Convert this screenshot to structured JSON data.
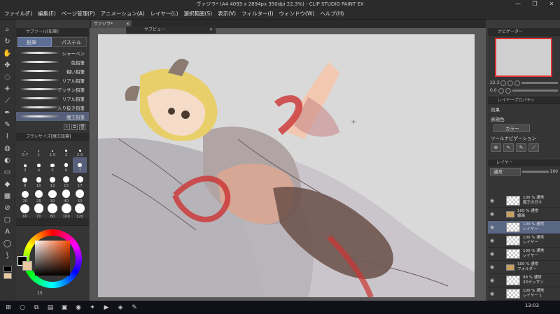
{
  "window": {
    "title": "ヴァジラ* (A4 4093 x 2894px 350dpi 22.3%) - CLIP STUDIO PAINT EX",
    "controls": [
      "—",
      "❐",
      "✕"
    ]
  },
  "menu": [
    "ファイル(F)",
    "編集(E)",
    "ページ管理(P)",
    "アニメーション(A)",
    "レイヤー(L)",
    "選択範囲(S)",
    "表示(V)",
    "フィルター(I)",
    "ウィンドウ(W)",
    "ヘルプ(H)"
  ],
  "tools": [
    "zoom-icon",
    "rotate-icon",
    "hand-icon",
    "move-icon",
    "lasso-icon",
    "auto-select-icon",
    "eyedropper-icon",
    "pen-icon",
    "pencil-icon",
    "brush-icon",
    "airbrush-icon",
    "blend-icon",
    "eraser-icon",
    "fill-icon",
    "gradient-icon",
    "figure-icon",
    "frame-icon",
    "text-icon",
    "balloon-icon",
    "line-correct-icon"
  ],
  "subtool": {
    "header": "サブツール[鉛筆]",
    "tabs": [
      "鉛筆",
      "パステル"
    ],
    "brushes": [
      "シャーペン",
      "色鉛筆",
      "粗い鉛筆",
      "リアル鉛筆",
      "デッサン鉛筆",
      "リアル鉛筆",
      "入り抜き鉛筆",
      "魔王鉛筆"
    ],
    "selected": "魔王鉛筆"
  },
  "brushsize": {
    "header": "ブラシサイズ[魔王鉛筆]",
    "sizes": [
      "0.7",
      "1",
      "1.5",
      "2",
      "2.5",
      "3",
      "4",
      "5",
      "6",
      "7",
      "8",
      "10",
      "12",
      "15",
      "17",
      "20",
      "25",
      "30",
      "40",
      "50",
      "60",
      "70",
      "80",
      "100",
      "120"
    ],
    "selected": "7"
  },
  "colorpanel": {
    "bottom_value": "15",
    "foreground": "#000000",
    "background": "#e8c9a0",
    "hue": "#ff4a00"
  },
  "document_tab": {
    "label": "ヴァジラ*",
    "close": "✕"
  },
  "subview": {
    "label": "サブビュー",
    "close": "✕"
  },
  "navigator": {
    "header": "ナビゲーター",
    "zoom": "22.3",
    "rotate": "0.0"
  },
  "layerprop": {
    "header": "レイヤープロパティ",
    "effect": "効果",
    "display_color": "表現色",
    "color_value": "カラー",
    "ruler_nav": "ツールナビゲーション"
  },
  "layers": {
    "header": "レイヤー",
    "blend": "通常",
    "opacity": "100",
    "rows": [
      {
        "line1": "100 % 通常",
        "line2": "魔王の日々"
      },
      {
        "line1": "100 % 通常",
        "line2": "線画"
      },
      {
        "line1": "100 % 通常",
        "line2": "レイヤー"
      },
      {
        "line1": "100 % 通常",
        "line2": "レイヤー"
      },
      {
        "line1": "100 % 通常",
        "line2": "レイヤー"
      },
      {
        "line1": "100 % 通常",
        "line2": "フォルダー"
      },
      {
        "line1": "98 % 通常",
        "line2": "3Dデッサン"
      },
      {
        "line1": "100 % 通常",
        "line2": "レイヤー 1"
      }
    ]
  },
  "taskbar": {
    "time": "13:03",
    "apps": [
      "windows-icon",
      "search-icon",
      "task-view-icon",
      "explorer-icon",
      "store-icon",
      "chrome-icon",
      "twitter-icon",
      "youtube-icon",
      "discord-icon",
      "clipstudio-icon"
    ]
  }
}
